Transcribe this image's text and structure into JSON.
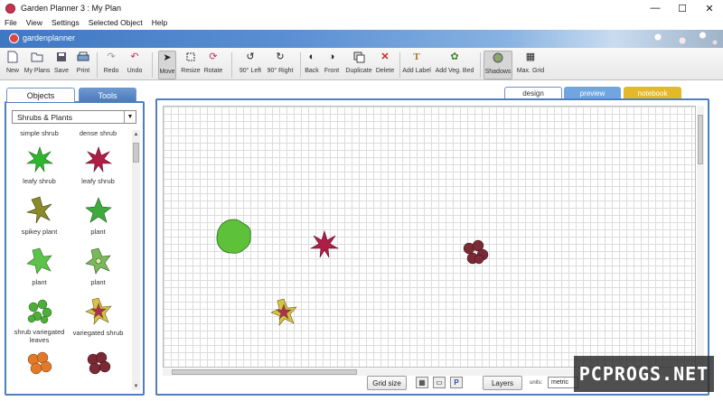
{
  "window": {
    "title": "Garden Planner 3 : My  Plan",
    "controls": [
      "—",
      "☐",
      "✕"
    ]
  },
  "menu": [
    "File",
    "View",
    "Settings",
    "Selected Object",
    "Help"
  ],
  "brand": {
    "text": "gardenplanner"
  },
  "toolbar": {
    "new": "New",
    "my_plans": "My Plans",
    "save": "Save",
    "print": "Print",
    "redo": "Redo",
    "undo": "Undo",
    "move": "Move",
    "resize": "Resize",
    "rotate": "Rotate",
    "rot_left": "90° Left",
    "rot_right": "90° Right",
    "back": "Back",
    "front": "Front",
    "duplicate": "Duplicate",
    "delete": "Delete",
    "add_label": "Add Label",
    "add_veg_bed": "Add Veg. Bed",
    "shadows": "Shadows",
    "max_grid": "Max. Grid"
  },
  "left_panel": {
    "tabs": {
      "objects": "Objects",
      "tools": "Tools"
    },
    "category": "Shrubs & Plants",
    "items": [
      {
        "label": "simple shrub"
      },
      {
        "label": "dense shrub"
      },
      {
        "label": "leafy shrub"
      },
      {
        "label": "leafy shrub"
      },
      {
        "label": "spikey plant"
      },
      {
        "label": "plant"
      },
      {
        "label": "plant"
      },
      {
        "label": "plant"
      },
      {
        "label": "shrub variegated leaves"
      },
      {
        "label": "variegated shrub"
      }
    ]
  },
  "view_tabs": {
    "design": "design",
    "preview": "preview",
    "notebook": "notebook"
  },
  "bottom": {
    "grid_size": "Grid size",
    "layers": "Layers",
    "units_label": "units:",
    "units_value": "metric",
    "view_p": "P"
  },
  "watermark": "PCPROGS.NET",
  "colors": {
    "accent_blue": "#4f7fbd",
    "preview_tab": "#6fa6e0",
    "notebook_tab": "#e3b92a"
  }
}
